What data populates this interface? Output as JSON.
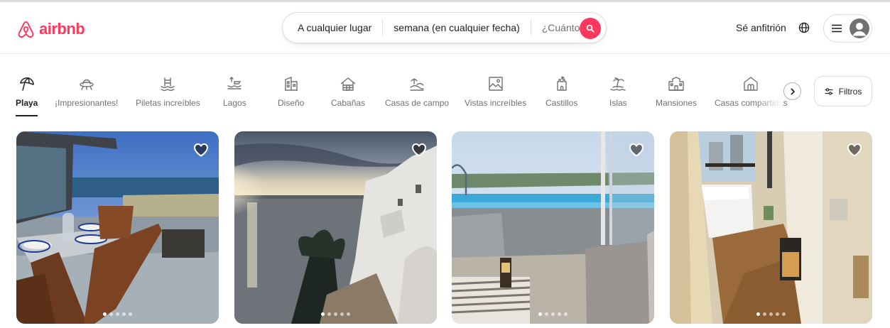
{
  "brand": {
    "name": "airbnb",
    "color": "#ff385c",
    "icon": "airbnb-logo-icon"
  },
  "search": {
    "location": "A cualquier lugar",
    "dates": "semana (en cualquier fecha)",
    "guests": "¿Cuántos?",
    "icon": "search-icon"
  },
  "header": {
    "host_label": "Sé anfitrión",
    "globe_icon": "globe-icon",
    "menu_icon": "hamburger-icon",
    "avatar_icon": "user-avatar-icon"
  },
  "categories": [
    {
      "label": "Playa",
      "icon": "beach-umbrella-icon",
      "active": true
    },
    {
      "label": "¡Impresionantes!",
      "icon": "ufo-icon"
    },
    {
      "label": "Piletas increíbles",
      "icon": "pool-icon"
    },
    {
      "label": "Lagos",
      "icon": "lake-icon"
    },
    {
      "label": "Diseño",
      "icon": "design-building-icon"
    },
    {
      "label": "Cabañas",
      "icon": "cabin-icon"
    },
    {
      "label": "Casas de campo",
      "icon": "countryside-icon"
    },
    {
      "label": "Vistas increíbles",
      "icon": "view-icon"
    },
    {
      "label": "Castillos",
      "icon": "castle-icon"
    },
    {
      "label": "Islas",
      "icon": "island-icon"
    },
    {
      "label": "Mansiones",
      "icon": "mansion-icon"
    },
    {
      "label": "Casas compartidas",
      "icon": "shared-home-icon"
    }
  ],
  "filters_label": "Filtros",
  "listings": [
    {
      "photo": "terrace-ocean-view",
      "image_count": 5,
      "current_image": 1
    },
    {
      "photo": "sunset-sea-white-building",
      "image_count": 5,
      "current_image": 1
    },
    {
      "photo": "rooftop-pool-sea-view",
      "image_count": 5,
      "current_image": 1
    },
    {
      "photo": "apartment-bedroom-hallway",
      "image_count": 5,
      "current_image": 1
    }
  ]
}
